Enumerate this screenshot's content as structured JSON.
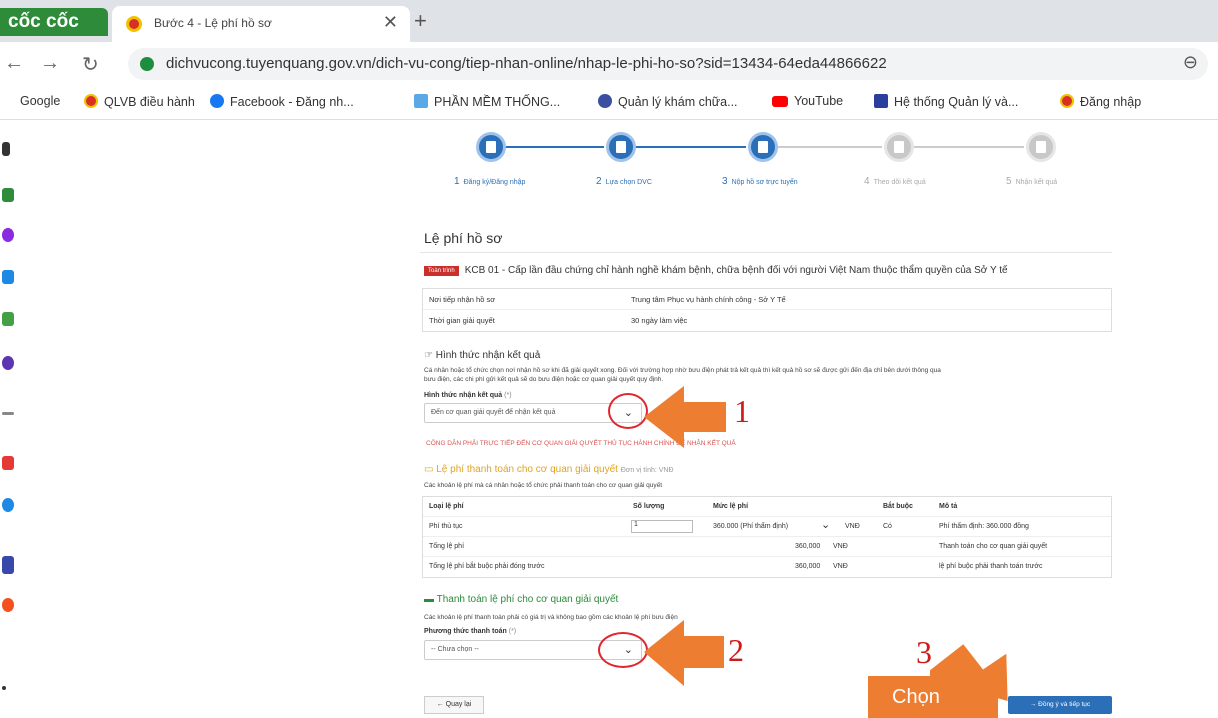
{
  "browser": {
    "brand": "cốc cốc",
    "tab_title": "Bước 4 - Lệ phí hồ sơ",
    "tab_close": "✕",
    "new_tab": "+",
    "url": "dichvucong.tuyenquang.gov.vn/dich-vu-cong/tiep-nhan-online/nhap-le-phi-ho-so?sid=13434-64eda44866622",
    "bookmarks": [
      "Google",
      "QLVB điều hành",
      "Facebook - Đăng nh...",
      "PHẦN MỀM THỐNG...",
      "Quản lý khám chữa...",
      "YouTube",
      "Hệ thống Quản lý và...",
      "Đăng nhập"
    ]
  },
  "stepper": [
    {
      "num": "1",
      "label": "Đăng ký/Đăng nhập"
    },
    {
      "num": "2",
      "label": "Lựa chọn DVC"
    },
    {
      "num": "3",
      "label": "Nộp hồ sơ trực tuyến"
    },
    {
      "num": "4",
      "label": "Theo dõi kết quả"
    },
    {
      "num": "5",
      "label": "Nhận kết quả"
    }
  ],
  "page": {
    "title": "Lệ phí hồ sơ",
    "badge": "Toàn trình",
    "procedure": "KCB 01 - Cấp lần đầu chứng chỉ hành nghề khám bệnh, chữa bệnh đối với người Việt Nam thuộc thẩm quyền của Sở Y tế",
    "info": [
      {
        "k": "Nơi tiếp nhận hồ sơ",
        "v": "Trung tâm Phục vụ hành chính công - Sở Y Tế"
      },
      {
        "k": "Thời gian giải quyết",
        "v": "30 ngày làm việc"
      }
    ],
    "result": {
      "heading": "Hình thức nhận kết quả",
      "desc1": "Cá nhân hoặc tổ chức chọn nơi nhận hồ sơ khi đã giải quyết xong. Đối với trường hợp nhờ bưu điện phát trả kết quả thì kết quả hồ sơ sẽ được gửi đến địa chỉ bên dưới thông qua",
      "desc2": "bưu điện, các chi phí gửi kết quả sẽ do bưu điện hoặc cơ quan giải quyết quy định.",
      "label": "Hình thức nhận kết quả",
      "required": "(*)",
      "selected": "Đến cơ quan giải quyết để nhận kết quả",
      "chevron": "⌄",
      "warning": "CÔNG DÂN PHẢI TRỰC TIẾP ĐẾN CƠ QUAN GIẢI QUYẾT THỦ TỤC HÀNH CHÍNH ĐỂ NHẬN KẾT QUẢ"
    },
    "fees": {
      "heading": "Lệ phí thanh toán cho cơ quan giải quyết",
      "unit": "Đơn vị tính: VNĐ",
      "desc": "Các khoản lệ phí mà cá nhân hoặc tổ chức phải thanh toán cho cơ quan giải quyết",
      "headers": [
        "Loại lệ phí",
        "Số lượng",
        "Mức lệ phí",
        "Bắt buộc",
        "Mô tả"
      ],
      "row1": {
        "type": "Phí thủ tục",
        "qty": "1",
        "amount": "360.000 (Phí thẩm định)",
        "chev": "⌄",
        "cur": "VNĐ",
        "req": "Có",
        "desc": "Phí thẩm định: 360.000 đồng"
      },
      "total": {
        "label": "Tổng lệ phí",
        "value": "360,000",
        "cur": "VNĐ",
        "desc": "Thanh toán cho cơ quan giải quyết"
      },
      "total_req": {
        "label": "Tổng lệ phí bắt buộc phải đóng trước",
        "value": "360,000",
        "cur": "VNĐ",
        "desc": "lệ phí buộc phải thanh toán trước"
      }
    },
    "payment": {
      "heading": "Thanh toán lệ phí cho cơ quan giải quyết",
      "desc": "Các khoản lệ phí thanh toán phải có giá trị và không bao gồm các khoản lệ phí bưu điện",
      "label": "Phương thức thanh toán",
      "required": "(*)",
      "selected": "-- Chưa chọn --",
      "chevron": "⌄"
    },
    "back": "← Quay lại",
    "next": "→ Đồng ý và tiếp tục"
  },
  "annotations": {
    "n1": "1",
    "n2": "2",
    "n3": "3",
    "chon": "Chọn",
    "color": "#ed7d31"
  }
}
